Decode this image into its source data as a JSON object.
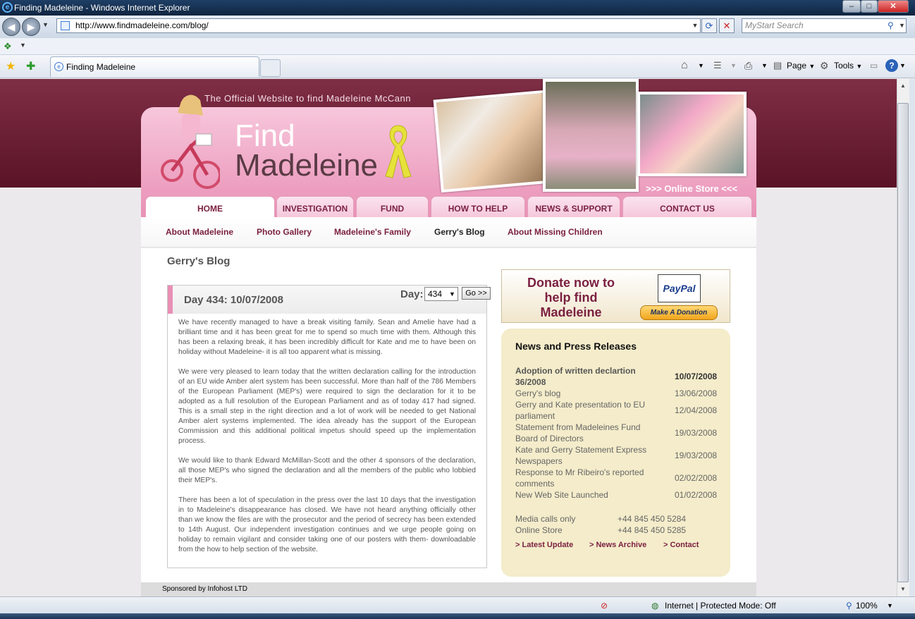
{
  "window": {
    "title": "Finding Madeleine - Windows Internet Explorer"
  },
  "browser": {
    "url": "http://www.findmadeleine.com/blog/",
    "search_placeholder": "MyStart Search",
    "tab_title": "Finding Madeleine",
    "tools": {
      "page": "Page",
      "tools": "Tools"
    }
  },
  "header": {
    "tagline": "The Official Website to find Madeleine McCann",
    "logo_line1": "Find",
    "logo_line2": "Madeleine",
    "store_link": ">>> Online Store <<<"
  },
  "nav": {
    "tabs": [
      "HOME",
      "INVESTIGATION",
      "FUND",
      "HOW TO HELP",
      "NEWS & SUPPORT",
      "CONTACT US"
    ],
    "subnav": [
      "About Madeleine",
      "Photo Gallery",
      "Madeleine's Family",
      "Gerry's Blog",
      "About Missing Children"
    ]
  },
  "page": {
    "title": "Gerry's Blog"
  },
  "blog": {
    "entry_title": "Day 434: 10/07/2008",
    "day_label": "Day:",
    "day_value": "434",
    "go_label": "Go >>",
    "paragraphs": [
      "We have recently managed to have a break visiting family. Sean and Amelie have had a brilliant time and it has been great for me to spend so much time with them. Although this has been a relaxing break, it has been incredibly difficult for Kate and me to have been on holiday without Madeleine- it is all too apparent what is missing.",
      "We were very pleased to learn today that the written declaration calling for the introduction of an EU wide Amber alert system has been successful. More than half of the 786 Members of the European Parliament (MEP's) were required to sign the declaration for it to be adopted as a full resolution of the European Parliament and as of today 417 had signed. This is a small step in the right direction and a lot of work will be needed to get National Amber alert systems implemented. The idea already has the support of the European Commission and this additional political impetus should speed up the implementation process.",
      "We would like to thank Edward McMillan-Scott and the other 4 sponsors of the declaration, all those MEP's who signed the declaration and all the members of the public who lobbied their MEP's.",
      "There has been a lot of speculation in the press over the last 10 days that the investigation in to Madeleine's disappearance has closed. We have not heard anything officially other than we know the files are with the prosecutor and the period of secrecy has been extended to 14th August. Our independent investigation continues and we urge people going on holiday to remain vigilant and consider taking one of our posters with them- downloadable from the how to help section of the website."
    ]
  },
  "donate": {
    "text": "Donate now to help find Madeleine",
    "paypal_logo": "PayPal",
    "button": "Make A Donation"
  },
  "news": {
    "title": "News and Press Releases",
    "items": [
      {
        "title": "Adoption of written declartion 36/2008",
        "date": "10/07/2008"
      },
      {
        "title": "Gerry's blog",
        "date": "13/06/2008"
      },
      {
        "title": "Gerry and Kate presentation to EU parliament",
        "date": "12/04/2008"
      },
      {
        "title": "Statement from Madeleines Fund Board of Directors",
        "date": "19/03/2008"
      },
      {
        "title": "Kate and Gerry Statement Express Newspapers",
        "date": "19/03/2008"
      },
      {
        "title": "Response to Mr Ribeiro's reported comments",
        "date": "02/02/2008"
      },
      {
        "title": "New Web Site Launched",
        "date": "01/02/2008"
      }
    ],
    "contacts": [
      {
        "label": "Media calls only",
        "value": "+44 845 450 5284"
      },
      {
        "label": "Online Store",
        "value": "+44 845 450 5285"
      }
    ],
    "links": [
      "> Latest Update",
      "> News Archive",
      "> Contact"
    ]
  },
  "footer": {
    "text": "Sponsored by Infohost LTD"
  },
  "status": {
    "zone": "Internet | Protected Mode: Off",
    "zoom": "100%"
  },
  "colors": {
    "brand_maroon": "#7a1f40",
    "brand_pink": "#e98fb5",
    "news_bg": "#f4ecca"
  }
}
